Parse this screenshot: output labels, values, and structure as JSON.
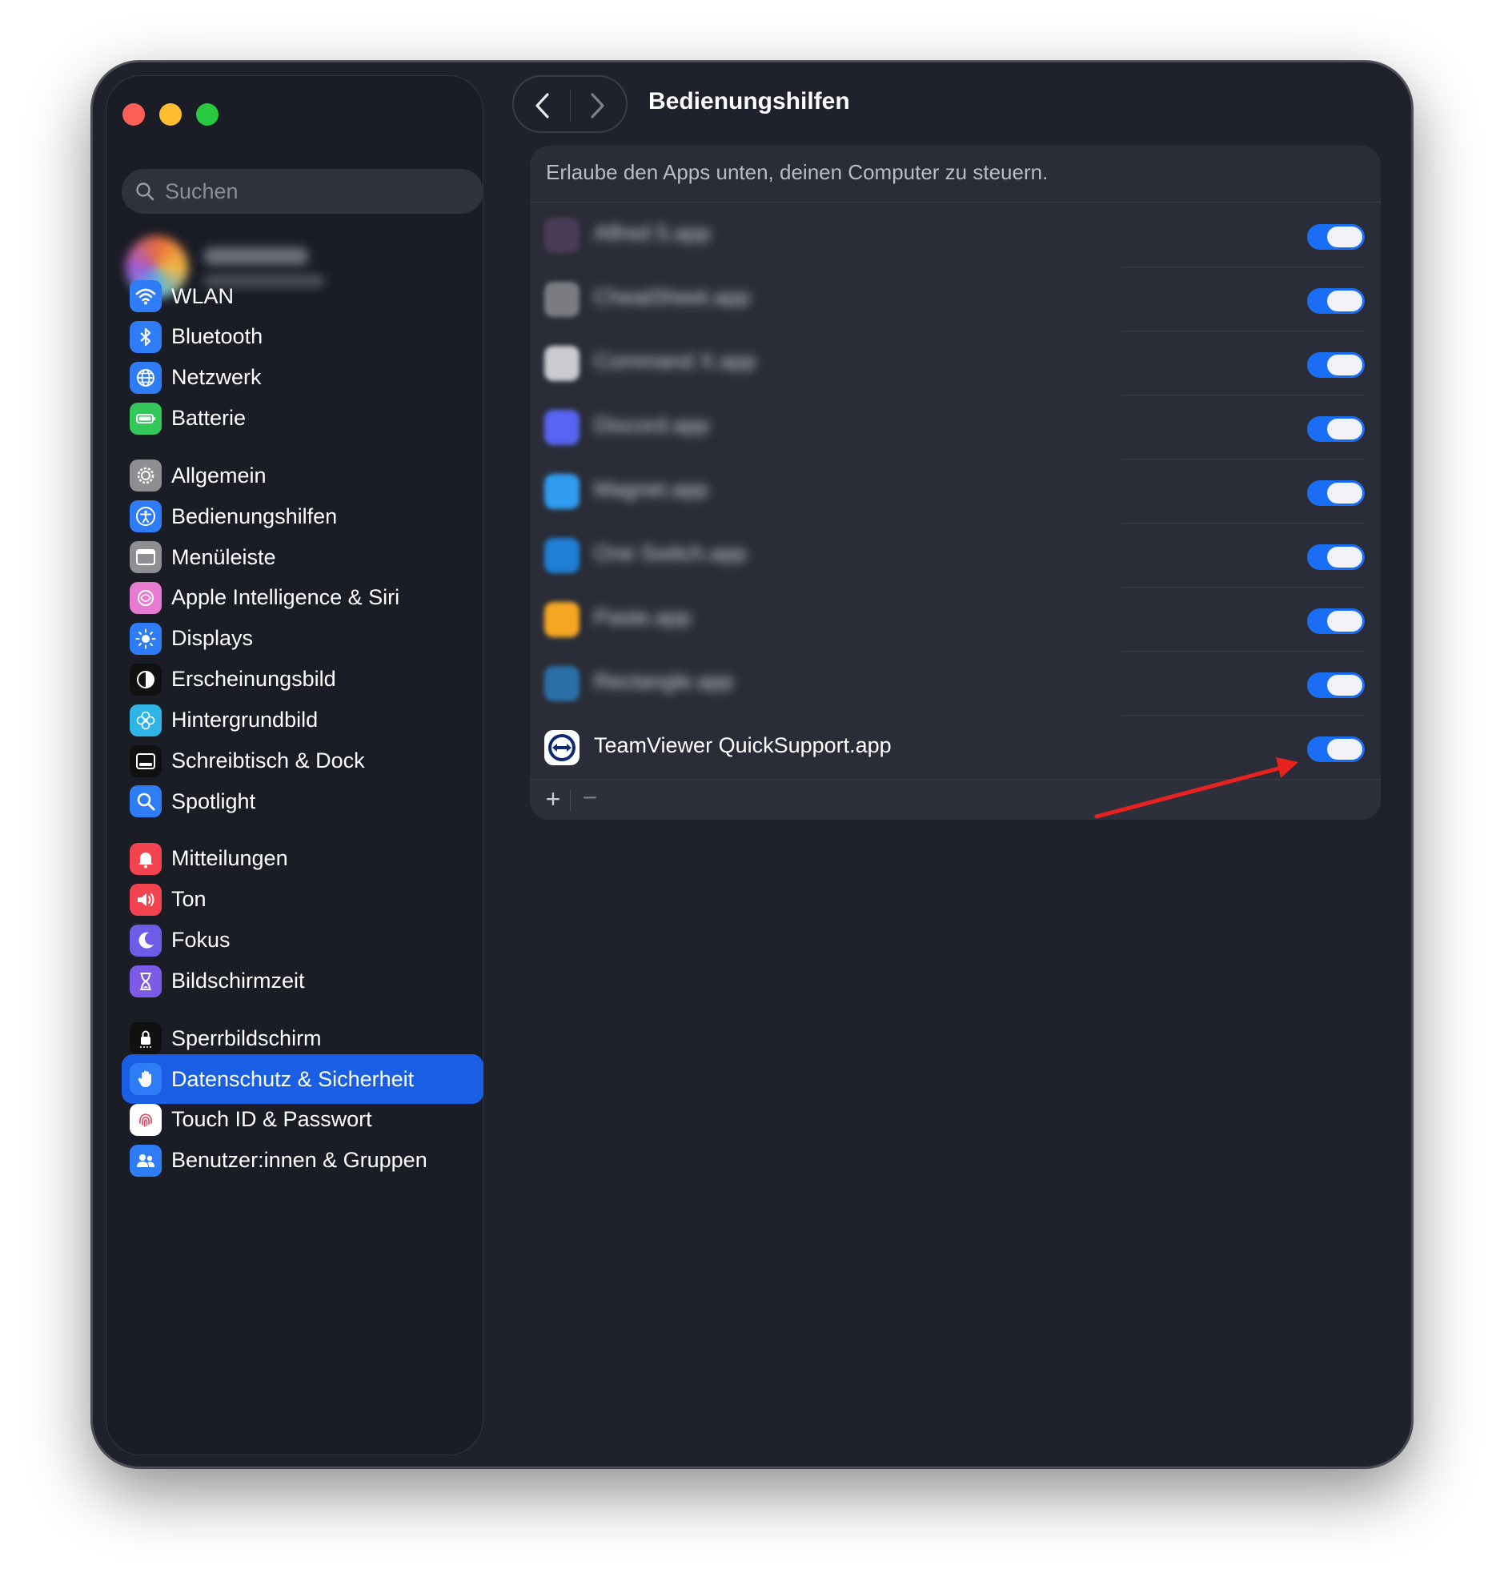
{
  "window": {
    "traffic_lights": [
      "close",
      "minimize",
      "zoom"
    ]
  },
  "sidebar": {
    "search_placeholder": "Suchen",
    "groups": [
      [
        {
          "label": "WLAN",
          "icon": "wifi-icon",
          "color": "#2e7cf6"
        },
        {
          "label": "Bluetooth",
          "icon": "bluetooth-icon",
          "color": "#2e7cf6"
        },
        {
          "label": "Netzwerk",
          "icon": "globe-icon",
          "color": "#2e7cf6"
        },
        {
          "label": "Batterie",
          "icon": "battery-icon",
          "color": "#34c759"
        }
      ],
      [
        {
          "label": "Allgemein",
          "icon": "gear-icon",
          "color": "#8e8e93"
        },
        {
          "label": "Bedienungshilfen",
          "icon": "accessibility-icon",
          "color": "#2e7cf6"
        },
        {
          "label": "Menüleiste",
          "icon": "menubar-icon",
          "color": "#8e8e93"
        },
        {
          "label": "Apple Intelligence & Siri",
          "icon": "siri-icon",
          "color": "#e77bd2"
        },
        {
          "label": "Displays",
          "icon": "sun-icon",
          "color": "#2e7cf6"
        },
        {
          "label": "Erscheinungsbild",
          "icon": "appearance-icon",
          "color": "#111111"
        },
        {
          "label": "Hintergrundbild",
          "icon": "flower-icon",
          "color": "#2fb4e8"
        },
        {
          "label": "Schreibtisch & Dock",
          "icon": "dock-icon",
          "color": "#111111"
        },
        {
          "label": "Spotlight",
          "icon": "magnifier-icon",
          "color": "#2e7cf6"
        }
      ],
      [
        {
          "label": "Mitteilungen",
          "icon": "bell-icon",
          "color": "#f2434f"
        },
        {
          "label": "Ton",
          "icon": "speaker-icon",
          "color": "#f2434f"
        },
        {
          "label": "Fokus",
          "icon": "moon-icon",
          "color": "#6e5ce6"
        },
        {
          "label": "Bildschirmzeit",
          "icon": "hourglass-icon",
          "color": "#7c5ce6"
        }
      ],
      [
        {
          "label": "Sperrbildschirm",
          "icon": "lock-icon",
          "color": "#111111"
        },
        {
          "label": "Datenschutz & Sicherheit",
          "icon": "hand-icon",
          "color": "#2e7cf6",
          "selected": true
        },
        {
          "label": "Touch ID & Passwort",
          "icon": "fingerprint-icon",
          "color": "#ffffff"
        },
        {
          "label": "Benutzer:innen & Gruppen",
          "icon": "users-icon",
          "color": "#2e7cf6"
        }
      ]
    ]
  },
  "header": {
    "title": "Bedienungshilfen"
  },
  "panel": {
    "description": "Erlaube den Apps unten, deinen Computer zu steuern.",
    "apps": [
      {
        "name": "Alfred 5.app",
        "enabled": true,
        "blurred": true,
        "icon_color": "#4a3b57"
      },
      {
        "name": "CheatSheet.app",
        "enabled": true,
        "blurred": true,
        "icon_color": "#7a7c82"
      },
      {
        "name": "Command X.app",
        "enabled": true,
        "blurred": true,
        "icon_color": "#c9cbd0"
      },
      {
        "name": "Discord.app",
        "enabled": true,
        "blurred": true,
        "icon_color": "#5865f2"
      },
      {
        "name": "Magnet.app",
        "enabled": true,
        "blurred": true,
        "icon_color": "#2f9cf0"
      },
      {
        "name": "One Switch.app",
        "enabled": true,
        "blurred": true,
        "icon_color": "#1f7fd6"
      },
      {
        "name": "Paste.app",
        "enabled": true,
        "blurred": true,
        "icon_color": "#f5a623"
      },
      {
        "name": "Rectangle.app",
        "enabled": true,
        "blurred": true,
        "icon_color": "#2a6fa8"
      },
      {
        "name": "TeamViewer QuickSupport.app",
        "enabled": true,
        "blurred": false,
        "icon_color": "#0e2a75"
      }
    ],
    "add_label": "+",
    "remove_label": "−"
  },
  "annotation": {
    "arrow_color": "#e8231f"
  }
}
